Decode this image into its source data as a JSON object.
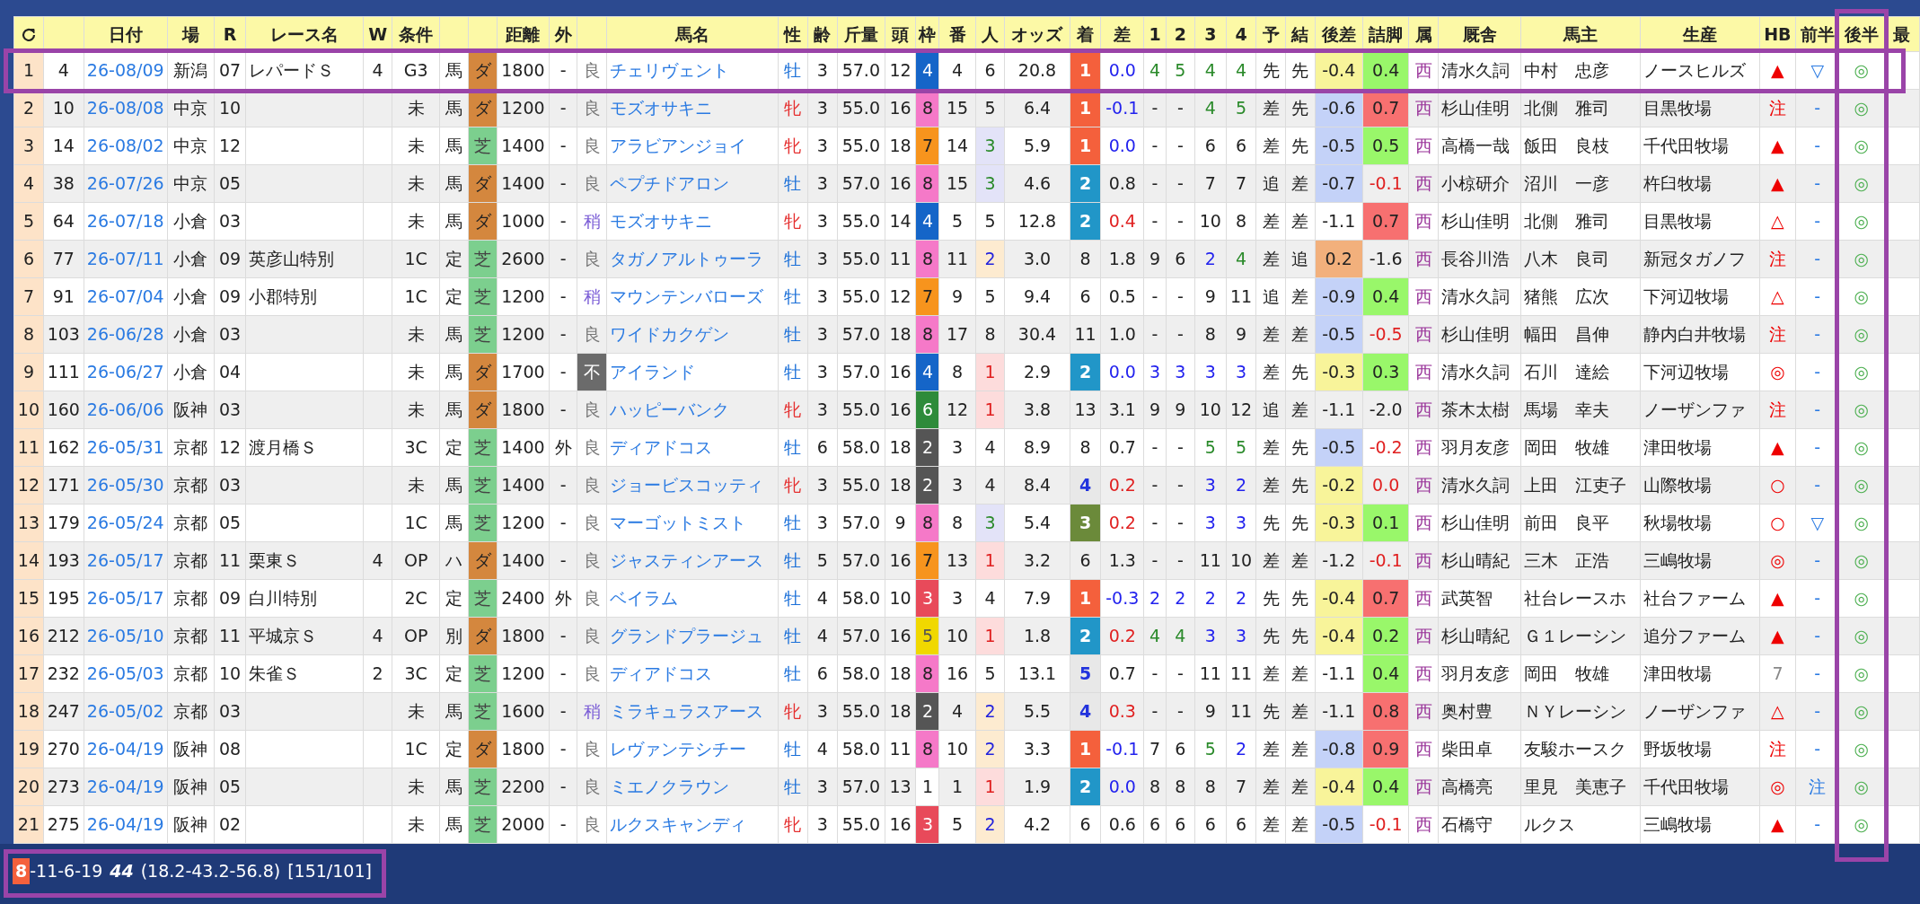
{
  "columns": [
    {
      "kind": "index"
    },
    {
      "kind": "plain"
    },
    {
      "kind": "link",
      "label": "日付"
    },
    {
      "kind": "plain",
      "label": "場"
    },
    {
      "kind": "plain",
      "label": "R"
    },
    {
      "kind": "plain",
      "label": "レース名"
    },
    {
      "kind": "plain",
      "label": "W"
    },
    {
      "kind": "plain",
      "label": "条件"
    },
    {
      "kind": "plain"
    },
    {
      "kind": "plain"
    },
    {
      "kind": "plain",
      "label": "距離"
    },
    {
      "kind": "plain",
      "label": "外"
    },
    {
      "kind": "plain"
    },
    {
      "kind": "link",
      "label": "馬名"
    },
    {
      "kind": "plain",
      "label": "性"
    },
    {
      "kind": "plain",
      "label": "齢"
    },
    {
      "kind": "plain",
      "label": "斤量"
    },
    {
      "kind": "plain",
      "label": "頭"
    },
    {
      "kind": "plain",
      "label": "枠"
    },
    {
      "kind": "plain",
      "label": "番"
    },
    {
      "kind": "plain",
      "label": "人"
    },
    {
      "kind": "plain",
      "label": "オッズ"
    },
    {
      "kind": "rank",
      "label": "着"
    },
    {
      "kind": "plain",
      "label": "差"
    },
    {
      "kind": "plain",
      "label": "1"
    },
    {
      "kind": "plain",
      "label": "2"
    },
    {
      "kind": "plain",
      "label": "3"
    },
    {
      "kind": "plain",
      "label": "4"
    },
    {
      "kind": "plain",
      "label": "予"
    },
    {
      "kind": "plain",
      "label": "結"
    },
    {
      "kind": "plain",
      "label": "後差"
    },
    {
      "kind": "plain",
      "label": "詰脚"
    },
    {
      "kind": "plain",
      "label": "属"
    },
    {
      "kind": "plain",
      "label": "厩舎"
    },
    {
      "kind": "plain",
      "label": "馬主"
    },
    {
      "kind": "plain",
      "label": "生産"
    },
    {
      "kind": "plain",
      "label": "HB"
    },
    {
      "kind": "plain",
      "label": "前半"
    },
    {
      "kind": "plain",
      "label": "後半",
      "highlighted": true
    },
    {
      "kind": "plain",
      "label": "最"
    }
  ],
  "rows": [
    {
      "highlighted": true,
      "cells": [
        "1",
        "4",
        "26-08/09",
        "新潟",
        "07",
        "レパードＳ",
        "4",
        "G3",
        "馬",
        {
          "kind": "fill",
          "text": "ダ",
          "color": "#d4873e"
        },
        "1800",
        "-",
        {
          "text": "良",
          "color": "#777777"
        },
        "チェリヴェント",
        {
          "text": "牡",
          "color": "#1a6fd8"
        },
        "3",
        "57.0",
        "12",
        {
          "kind": "fill",
          "color": "#1565c8",
          "label": {
            "text": "4",
            "color": "#ffffff"
          }
        },
        "4",
        "6",
        "20.8",
        {
          "kind": "fill",
          "color": "#f4603c",
          "label": {
            "text": "1",
            "color": "#ffffff"
          }
        },
        {
          "text": "0.0",
          "color": "#2222ee"
        },
        {
          "text": "4",
          "color": "#2a8a2a"
        },
        {
          "text": "5",
          "color": "#2a8a2a"
        },
        {
          "text": "4",
          "color": "#2a8a2a"
        },
        {
          "text": "4",
          "color": "#2a8a2a"
        },
        "先",
        "先",
        {
          "kind": "fill",
          "text": "-0.4",
          "color": "#f8f49a"
        },
        {
          "kind": "fill",
          "text": "0.4",
          "color": "#99f76a"
        },
        {
          "text": "西",
          "color": "#993399"
        },
        "清水久詞",
        "中村　忠彦",
        "ノースヒルズ",
        {
          "text": "▲",
          "color": "#ee0000"
        },
        {
          "text": "▽",
          "color": "#2a7ae2"
        },
        {
          "text": "◎",
          "color": "#4caf50"
        }
      ]
    },
    {
      "highlighted": false,
      "cells": [
        "2",
        "10",
        "26-08/08",
        "中京",
        "10",
        null,
        null,
        "未",
        "馬",
        {
          "kind": "fill",
          "text": "ダ",
          "color": "#d4873e"
        },
        "1200",
        "-",
        {
          "text": "良",
          "color": "#777777"
        },
        "モズオサキニ",
        {
          "text": "牝",
          "color": "#e53030"
        },
        "3",
        "55.0",
        "16",
        {
          "kind": "fill",
          "text": "8",
          "color": "#f579c8"
        },
        "15",
        "5",
        "6.4",
        {
          "kind": "fill",
          "color": "#f4603c",
          "label": {
            "text": "1",
            "color": "#ffffff"
          }
        },
        {
          "text": "-0.1",
          "color": "#2222ee"
        },
        "-",
        "-",
        {
          "text": "4",
          "color": "#2a8a2a"
        },
        {
          "text": "5",
          "color": "#2a8a2a"
        },
        "差",
        "先",
        {
          "kind": "fill",
          "text": "-0.6",
          "color": "#c4d2f8"
        },
        {
          "kind": "fill",
          "text": "0.7",
          "color": "#f77070"
        },
        {
          "text": "西",
          "color": "#993399"
        },
        "杉山佳明",
        "北側　雅司",
        "目黒牧場",
        {
          "text": "注",
          "color": "#ee0000"
        },
        {
          "text": "-",
          "color": "#2a7ae2"
        },
        {
          "text": "◎",
          "color": "#4caf50"
        }
      ]
    },
    {
      "highlighted": false,
      "cells": [
        "3",
        "14",
        "26-08/02",
        "中京",
        "12",
        null,
        null,
        "未",
        "馬",
        {
          "kind": "fill",
          "color": "#7ccf8e",
          "label": {
            "text": "芝",
            "color": "#444444"
          }
        },
        "1400",
        "-",
        {
          "text": "良",
          "color": "#777777"
        },
        "アラビアンジョイ",
        {
          "text": "牝",
          "color": "#e53030"
        },
        "3",
        "55.0",
        "18",
        {
          "kind": "fill",
          "text": "7",
          "color": "#f7941d"
        },
        "14",
        {
          "kind": "fill",
          "color": "#e3e3f8",
          "label": {
            "text": "3",
            "color": "#2a8a2a"
          }
        },
        "5.9",
        {
          "kind": "fill",
          "color": "#f4603c",
          "label": {
            "text": "1",
            "color": "#ffffff"
          }
        },
        {
          "text": "0.0",
          "color": "#2222ee"
        },
        "-",
        "-",
        "6",
        "6",
        "差",
        "先",
        {
          "kind": "fill",
          "text": "-0.5",
          "color": "#c4d2f8"
        },
        {
          "kind": "fill",
          "text": "0.5",
          "color": "#99f76a"
        },
        {
          "text": "西",
          "color": "#993399"
        },
        "高橋一哉",
        "飯田　良枝",
        "千代田牧場",
        {
          "text": "▲",
          "color": "#ee0000"
        },
        {
          "text": "-",
          "color": "#2a7ae2"
        },
        {
          "text": "◎",
          "color": "#4caf50"
        }
      ]
    },
    {
      "highlighted": false,
      "cells": [
        "4",
        "38",
        "26-07/26",
        "中京",
        "05",
        null,
        null,
        "未",
        "馬",
        {
          "kind": "fill",
          "text": "ダ",
          "color": "#d4873e"
        },
        "1400",
        "-",
        {
          "text": "良",
          "color": "#777777"
        },
        "ペプチドアロン",
        {
          "text": "牡",
          "color": "#1a6fd8"
        },
        "3",
        "57.0",
        "16",
        {
          "kind": "fill",
          "text": "8",
          "color": "#f579c8"
        },
        "15",
        {
          "kind": "fill",
          "color": "#e3e3f8",
          "label": {
            "text": "3",
            "color": "#2a8a2a"
          }
        },
        "4.6",
        {
          "kind": "fill",
          "color": "#2196c8",
          "label": {
            "text": "2",
            "color": "#ffffff"
          }
        },
        "0.8",
        "-",
        "-",
        "7",
        "7",
        "追",
        "差",
        {
          "kind": "fill",
          "text": "-0.7",
          "color": "#c4d2f8"
        },
        {
          "text": "-0.1",
          "color": "#e02020"
        },
        {
          "text": "西",
          "color": "#993399"
        },
        "小椋研介",
        "沼川　一彦",
        "杵臼牧場",
        {
          "text": "▲",
          "color": "#ee0000"
        },
        {
          "text": "-",
          "color": "#2a7ae2"
        },
        {
          "text": "◎",
          "color": "#4caf50"
        }
      ]
    },
    {
      "highlighted": false,
      "cells": [
        "5",
        "64",
        "26-07/18",
        "小倉",
        "03",
        null,
        null,
        "未",
        "馬",
        {
          "kind": "fill",
          "text": "ダ",
          "color": "#d4873e"
        },
        "1000",
        "-",
        {
          "text": "稍",
          "color": "#7a5cd6"
        },
        "モズオサキニ",
        {
          "text": "牝",
          "color": "#e53030"
        },
        "3",
        "55.0",
        "14",
        {
          "kind": "fill",
          "color": "#1565c8",
          "label": {
            "text": "4",
            "color": "#ffffff"
          }
        },
        "5",
        "5",
        "12.8",
        {
          "kind": "fill",
          "color": "#2196c8",
          "label": {
            "text": "2",
            "color": "#ffffff"
          }
        },
        {
          "text": "0.4",
          "color": "#e02020"
        },
        "-",
        "-",
        "10",
        "8",
        "差",
        "差",
        "-1.1",
        {
          "kind": "fill",
          "text": "0.7",
          "color": "#f77070"
        },
        {
          "text": "西",
          "color": "#993399"
        },
        "杉山佳明",
        "北側　雅司",
        "目黒牧場",
        {
          "text": "△",
          "color": "#ee0000"
        },
        {
          "text": "-",
          "color": "#2a7ae2"
        },
        {
          "text": "◎",
          "color": "#4caf50"
        }
      ]
    },
    {
      "highlighted": false,
      "cells": [
        "6",
        "77",
        "26-07/11",
        "小倉",
        "09",
        "英彦山特別",
        null,
        "1C",
        "定",
        {
          "kind": "fill",
          "color": "#7ccf8e",
          "label": {
            "text": "芝",
            "color": "#444444"
          }
        },
        "2600",
        "-",
        {
          "text": "良",
          "color": "#777777"
        },
        "タガノアルトゥーラ",
        {
          "text": "牡",
          "color": "#1a6fd8"
        },
        "3",
        "55.0",
        "11",
        {
          "kind": "fill",
          "text": "8",
          "color": "#f579c8"
        },
        "11",
        {
          "kind": "fill",
          "color": "#fdebd0",
          "label": {
            "text": "2",
            "color": "#2222dd"
          }
        },
        "3.0",
        "8",
        "1.8",
        "9",
        "6",
        {
          "text": "2",
          "color": "#2222ee"
        },
        {
          "text": "4",
          "color": "#2a8a2a"
        },
        "差",
        "追",
        {
          "kind": "fill",
          "text": "0.2",
          "color": "#f2b07c"
        },
        "-1.6",
        {
          "text": "西",
          "color": "#993399"
        },
        "長谷川浩",
        "八木　良司",
        "新冠タガノフ",
        {
          "text": "注",
          "color": "#ee0000"
        },
        {
          "text": "-",
          "color": "#2a7ae2"
        },
        {
          "text": "◎",
          "color": "#4caf50"
        }
      ]
    },
    {
      "highlighted": false,
      "cells": [
        "7",
        "91",
        "26-07/04",
        "小倉",
        "09",
        "小郡特別",
        null,
        "1C",
        "定",
        {
          "kind": "fill",
          "color": "#7ccf8e",
          "label": {
            "text": "芝",
            "color": "#444444"
          }
        },
        "1200",
        "-",
        {
          "text": "稍",
          "color": "#7a5cd6"
        },
        "マウンテンバローズ",
        {
          "text": "牡",
          "color": "#1a6fd8"
        },
        "3",
        "55.0",
        "12",
        {
          "kind": "fill",
          "text": "7",
          "color": "#f7941d"
        },
        "9",
        "5",
        "9.4",
        "6",
        "0.5",
        "-",
        "-",
        "9",
        "11",
        "追",
        "差",
        {
          "kind": "fill",
          "text": "-0.9",
          "color": "#c4d2f8"
        },
        {
          "kind": "fill",
          "text": "0.4",
          "color": "#99f76a"
        },
        {
          "text": "西",
          "color": "#993399"
        },
        "清水久詞",
        "猪熊　広次",
        "下河辺牧場",
        {
          "text": "△",
          "color": "#ee0000"
        },
        {
          "text": "-",
          "color": "#2a7ae2"
        },
        {
          "text": "◎",
          "color": "#4caf50"
        }
      ]
    },
    {
      "highlighted": false,
      "cells": [
        "8",
        "103",
        "26-06/28",
        "小倉",
        "03",
        null,
        null,
        "未",
        "馬",
        {
          "kind": "fill",
          "color": "#7ccf8e",
          "label": {
            "text": "芝",
            "color": "#444444"
          }
        },
        "1200",
        "-",
        {
          "text": "良",
          "color": "#777777"
        },
        "ワイドカクゲン",
        {
          "text": "牡",
          "color": "#1a6fd8"
        },
        "3",
        "57.0",
        "18",
        {
          "kind": "fill",
          "text": "8",
          "color": "#f579c8"
        },
        "17",
        "8",
        "30.4",
        "11",
        "1.0",
        "-",
        "-",
        "8",
        "9",
        "差",
        "差",
        {
          "kind": "fill",
          "text": "-0.5",
          "color": "#c4d2f8"
        },
        {
          "text": "-0.5",
          "color": "#e02020"
        },
        {
          "text": "西",
          "color": "#993399"
        },
        "杉山佳明",
        "幅田　昌伸",
        "静内白井牧場",
        {
          "text": "注",
          "color": "#ee0000"
        },
        {
          "text": "-",
          "color": "#2a7ae2"
        },
        {
          "text": "◎",
          "color": "#4caf50"
        }
      ]
    },
    {
      "highlighted": false,
      "cells": [
        "9",
        "111",
        "26-06/27",
        "小倉",
        "04",
        null,
        null,
        "未",
        "馬",
        {
          "kind": "fill",
          "text": "ダ",
          "color": "#d4873e"
        },
        "1700",
        "-",
        {
          "kind": "fill",
          "color": "#6b6b6b",
          "label": {
            "text": "不",
            "color": "#ffffff"
          }
        },
        "アイランド",
        {
          "text": "牡",
          "color": "#1a6fd8"
        },
        "3",
        "57.0",
        "16",
        {
          "kind": "fill",
          "color": "#1565c8",
          "label": {
            "text": "4",
            "color": "#ffffff"
          }
        },
        "8",
        {
          "kind": "fill",
          "color": "#fddcdc",
          "label": {
            "text": "1",
            "color": "#e02020"
          }
        },
        "2.9",
        {
          "kind": "fill",
          "color": "#2196c8",
          "label": {
            "text": "2",
            "color": "#ffffff"
          }
        },
        {
          "text": "0.0",
          "color": "#2222ee"
        },
        {
          "text": "3",
          "color": "#2222ee"
        },
        {
          "text": "3",
          "color": "#2222ee"
        },
        {
          "text": "3",
          "color": "#2222ee"
        },
        {
          "text": "3",
          "color": "#2222ee"
        },
        "差",
        "先",
        {
          "kind": "fill",
          "text": "-0.3",
          "color": "#f8f49a"
        },
        {
          "kind": "fill",
          "text": "0.3",
          "color": "#99f76a"
        },
        {
          "text": "西",
          "color": "#993399"
        },
        "清水久詞",
        "石川　達絵",
        "下河辺牧場",
        {
          "text": "◎",
          "color": "#ee0000"
        },
        {
          "text": "-",
          "color": "#2a7ae2"
        },
        {
          "text": "◎",
          "color": "#4caf50"
        }
      ]
    },
    {
      "highlighted": false,
      "cells": [
        "10",
        "160",
        "26-06/06",
        "阪神",
        "03",
        null,
        null,
        "未",
        "馬",
        {
          "kind": "fill",
          "text": "ダ",
          "color": "#d4873e"
        },
        "1800",
        "-",
        {
          "text": "良",
          "color": "#777777"
        },
        "ハッピーバンク",
        {
          "text": "牝",
          "color": "#e53030"
        },
        "3",
        "55.0",
        "16",
        {
          "kind": "fill",
          "color": "#2e8b3a",
          "label": {
            "text": "6",
            "color": "#ffffff"
          }
        },
        "12",
        {
          "kind": "fill",
          "color": "#fddcdc",
          "label": {
            "text": "1",
            "color": "#e02020"
          }
        },
        "3.8",
        "13",
        "3.1",
        "9",
        "9",
        "10",
        "12",
        "追",
        "差",
        "-1.1",
        "-2.0",
        {
          "text": "西",
          "color": "#993399"
        },
        "茶木太樹",
        "馬場　幸夫",
        "ノーザンファ",
        {
          "text": "注",
          "color": "#ee0000"
        },
        {
          "text": "-",
          "color": "#2a7ae2"
        },
        {
          "text": "◎",
          "color": "#4caf50"
        }
      ]
    },
    {
      "highlighted": false,
      "cells": [
        "11",
        "162",
        "26-05/31",
        "京都",
        "12",
        "渡月橋Ｓ",
        null,
        "3C",
        "定",
        {
          "kind": "fill",
          "color": "#7ccf8e",
          "label": {
            "text": "芝",
            "color": "#444444"
          }
        },
        "1400",
        "外",
        {
          "text": "良",
          "color": "#777777"
        },
        "ディアドコス",
        {
          "text": "牡",
          "color": "#1a6fd8"
        },
        "6",
        "58.0",
        "18",
        {
          "kind": "fill",
          "color": "#555555",
          "label": {
            "text": "2",
            "color": "#ffffff"
          }
        },
        "3",
        "4",
        "8.9",
        "8",
        "0.7",
        "-",
        "-",
        {
          "text": "5",
          "color": "#2a8a2a"
        },
        {
          "text": "5",
          "color": "#2a8a2a"
        },
        "差",
        "先",
        {
          "kind": "fill",
          "text": "-0.5",
          "color": "#c4d2f8"
        },
        {
          "text": "-0.2",
          "color": "#e02020"
        },
        {
          "text": "西",
          "color": "#993399"
        },
        "羽月友彦",
        "岡田　牧雄",
        "津田牧場",
        {
          "text": "▲",
          "color": "#ee0000"
        },
        {
          "text": "-",
          "color": "#2a7ae2"
        },
        {
          "text": "◎",
          "color": "#4caf50"
        }
      ]
    },
    {
      "highlighted": false,
      "cells": [
        "12",
        "171",
        "26-05/30",
        "京都",
        "03",
        null,
        null,
        "未",
        "馬",
        {
          "kind": "fill",
          "color": "#7ccf8e",
          "label": {
            "text": "芝",
            "color": "#444444"
          }
        },
        "1400",
        "-",
        {
          "text": "良",
          "color": "#777777"
        },
        "ジョービスコッティ",
        {
          "text": "牝",
          "color": "#e53030"
        },
        "3",
        "55.0",
        "18",
        {
          "kind": "fill",
          "color": "#555555",
          "label": {
            "text": "2",
            "color": "#ffffff"
          }
        },
        "3",
        "4",
        "8.4",
        {
          "kind": "fill",
          "color": "#e8e8e8",
          "label": {
            "text": "4",
            "color": "#2233dd"
          }
        },
        {
          "text": "0.2",
          "color": "#e02020"
        },
        "-",
        "-",
        {
          "text": "3",
          "color": "#2222ee"
        },
        {
          "text": "2",
          "color": "#2222ee"
        },
        "差",
        "先",
        {
          "kind": "fill",
          "text": "-0.2",
          "color": "#f8f49a"
        },
        {
          "text": "0.0",
          "color": "#e02020"
        },
        {
          "text": "西",
          "color": "#993399"
        },
        "清水久詞",
        "上田　江吏子",
        "山際牧場",
        {
          "text": "○",
          "color": "#ee0000"
        },
        {
          "text": "-",
          "color": "#2a7ae2"
        },
        {
          "text": "◎",
          "color": "#4caf50"
        }
      ]
    },
    {
      "highlighted": false,
      "cells": [
        "13",
        "179",
        "26-05/24",
        "京都",
        "05",
        null,
        null,
        "1C",
        "馬",
        {
          "kind": "fill",
          "color": "#7ccf8e",
          "label": {
            "text": "芝",
            "color": "#444444"
          }
        },
        "1200",
        "-",
        {
          "text": "良",
          "color": "#777777"
        },
        "マーゴットミスト",
        {
          "text": "牡",
          "color": "#1a6fd8"
        },
        "3",
        "57.0",
        "9",
        {
          "kind": "fill",
          "text": "8",
          "color": "#f579c8"
        },
        "8",
        {
          "kind": "fill",
          "color": "#e3e3f8",
          "label": {
            "text": "3",
            "color": "#2a8a2a"
          }
        },
        "5.4",
        {
          "kind": "fill",
          "color": "#6b8a3a",
          "label": {
            "text": "3",
            "color": "#ffffff"
          }
        },
        {
          "text": "0.2",
          "color": "#e02020"
        },
        "-",
        "-",
        {
          "text": "3",
          "color": "#2222ee"
        },
        {
          "text": "3",
          "color": "#2222ee"
        },
        "先",
        "先",
        {
          "kind": "fill",
          "text": "-0.3",
          "color": "#f8f49a"
        },
        {
          "kind": "fill",
          "text": "0.1",
          "color": "#99f76a"
        },
        {
          "text": "西",
          "color": "#993399"
        },
        "杉山佳明",
        "前田　良平",
        "秋場牧場",
        {
          "text": "○",
          "color": "#ee0000"
        },
        {
          "text": "▽",
          "color": "#2a7ae2"
        },
        {
          "text": "◎",
          "color": "#4caf50"
        }
      ]
    },
    {
      "highlighted": false,
      "cells": [
        "14",
        "193",
        "26-05/17",
        "京都",
        "11",
        "栗東Ｓ",
        "4",
        "OP",
        "ハ",
        {
          "kind": "fill",
          "text": "ダ",
          "color": "#d4873e"
        },
        "1400",
        "-",
        {
          "text": "良",
          "color": "#777777"
        },
        "ジャスティンアース",
        {
          "text": "牡",
          "color": "#1a6fd8"
        },
        "5",
        "57.0",
        "16",
        {
          "kind": "fill",
          "text": "7",
          "color": "#f7941d"
        },
        "13",
        {
          "kind": "fill",
          "color": "#fddcdc",
          "label": {
            "text": "1",
            "color": "#e02020"
          }
        },
        "3.2",
        "6",
        "1.3",
        "-",
        "-",
        "11",
        "10",
        "差",
        "差",
        "-1.2",
        {
          "text": "-0.1",
          "color": "#e02020"
        },
        {
          "text": "西",
          "color": "#993399"
        },
        "杉山晴紀",
        "三木　正浩",
        "三嶋牧場",
        {
          "text": "◎",
          "color": "#ee0000"
        },
        {
          "text": "-",
          "color": "#2a7ae2"
        },
        {
          "text": "◎",
          "color": "#4caf50"
        }
      ]
    },
    {
      "highlighted": false,
      "cells": [
        "15",
        "195",
        "26-05/17",
        "京都",
        "09",
        "白川特別",
        null,
        "2C",
        "定",
        {
          "kind": "fill",
          "color": "#7ccf8e",
          "label": {
            "text": "芝",
            "color": "#444444"
          }
        },
        "2400",
        "外",
        {
          "text": "良",
          "color": "#777777"
        },
        "ベイラム",
        {
          "text": "牡",
          "color": "#1a6fd8"
        },
        "4",
        "58.0",
        "10",
        {
          "kind": "fill",
          "color": "#e84a5a",
          "label": {
            "text": "3",
            "color": "#ffffff"
          }
        },
        "3",
        "4",
        "7.9",
        {
          "kind": "fill",
          "color": "#f4603c",
          "label": {
            "text": "1",
            "color": "#ffffff"
          }
        },
        {
          "text": "-0.3",
          "color": "#2222ee"
        },
        {
          "text": "2",
          "color": "#2222ee"
        },
        {
          "text": "2",
          "color": "#2222ee"
        },
        {
          "text": "2",
          "color": "#2222ee"
        },
        {
          "text": "2",
          "color": "#2222ee"
        },
        "先",
        "先",
        {
          "kind": "fill",
          "text": "-0.4",
          "color": "#f8f49a"
        },
        {
          "kind": "fill",
          "text": "0.7",
          "color": "#f77070"
        },
        {
          "text": "西",
          "color": "#993399"
        },
        "武英智",
        "社台レースホ",
        "社台ファーム",
        {
          "text": "▲",
          "color": "#ee0000"
        },
        {
          "text": "-",
          "color": "#2a7ae2"
        },
        {
          "text": "◎",
          "color": "#4caf50"
        }
      ]
    },
    {
      "highlighted": false,
      "cells": [
        "16",
        "212",
        "26-05/10",
        "京都",
        "11",
        "平城京Ｓ",
        "4",
        "OP",
        "別",
        {
          "kind": "fill",
          "text": "ダ",
          "color": "#d4873e"
        },
        "1800",
        "-",
        {
          "text": "良",
          "color": "#777777"
        },
        "グランドプラージュ",
        {
          "text": "牡",
          "color": "#1a6fd8"
        },
        "4",
        "57.0",
        "16",
        {
          "kind": "fill",
          "color": "#f0d800",
          "label": {
            "text": "5",
            "color": "#555555"
          }
        },
        "10",
        {
          "kind": "fill",
          "color": "#fddcdc",
          "label": {
            "text": "1",
            "color": "#e02020"
          }
        },
        "1.8",
        {
          "kind": "fill",
          "color": "#2196c8",
          "label": {
            "text": "2",
            "color": "#ffffff"
          }
        },
        {
          "text": "0.2",
          "color": "#e02020"
        },
        {
          "text": "4",
          "color": "#2a8a2a"
        },
        {
          "text": "4",
          "color": "#2a8a2a"
        },
        {
          "text": "3",
          "color": "#2222ee"
        },
        {
          "text": "3",
          "color": "#2222ee"
        },
        "先",
        "先",
        {
          "kind": "fill",
          "text": "-0.4",
          "color": "#f8f49a"
        },
        {
          "kind": "fill",
          "text": "0.2",
          "color": "#99f76a"
        },
        {
          "text": "西",
          "color": "#993399"
        },
        "杉山晴紀",
        "Ｇ１レーシン",
        "追分ファーム",
        {
          "text": "▲",
          "color": "#ee0000"
        },
        {
          "text": "-",
          "color": "#2a7ae2"
        },
        {
          "text": "◎",
          "color": "#4caf50"
        }
      ]
    },
    {
      "highlighted": false,
      "cells": [
        "17",
        "232",
        "26-05/03",
        "京都",
        "10",
        "朱雀Ｓ",
        "2",
        "3C",
        "定",
        {
          "kind": "fill",
          "color": "#7ccf8e",
          "label": {
            "text": "芝",
            "color": "#444444"
          }
        },
        "1200",
        "-",
        {
          "text": "良",
          "color": "#777777"
        },
        "ディアドコス",
        {
          "text": "牡",
          "color": "#1a6fd8"
        },
        "6",
        "58.0",
        "18",
        {
          "kind": "fill",
          "text": "8",
          "color": "#f579c8"
        },
        "16",
        "5",
        "13.1",
        {
          "kind": "fill",
          "color": "#e8e8e8",
          "label": {
            "text": "5",
            "color": "#2233dd"
          }
        },
        "0.7",
        "-",
        "-",
        "11",
        "11",
        "差",
        "差",
        "-1.1",
        {
          "kind": "fill",
          "text": "0.4",
          "color": "#99f76a"
        },
        {
          "text": "西",
          "color": "#993399"
        },
        "羽月友彦",
        "岡田　牧雄",
        "津田牧場",
        {
          "text": "7",
          "color": "#888888"
        },
        {
          "text": "-",
          "color": "#2a7ae2"
        },
        {
          "text": "◎",
          "color": "#4caf50"
        }
      ]
    },
    {
      "highlighted": false,
      "cells": [
        "18",
        "247",
        "26-05/02",
        "京都",
        "03",
        null,
        null,
        "未",
        "馬",
        {
          "kind": "fill",
          "color": "#7ccf8e",
          "label": {
            "text": "芝",
            "color": "#444444"
          }
        },
        "1600",
        "-",
        {
          "text": "稍",
          "color": "#7a5cd6"
        },
        "ミラキュラスアース",
        {
          "text": "牝",
          "color": "#e53030"
        },
        "3",
        "55.0",
        "18",
        {
          "kind": "fill",
          "color": "#555555",
          "label": {
            "text": "2",
            "color": "#ffffff"
          }
        },
        "4",
        {
          "kind": "fill",
          "color": "#fdebd0",
          "label": {
            "text": "2",
            "color": "#2222dd"
          }
        },
        "5.5",
        {
          "kind": "fill",
          "color": "#e8e8e8",
          "label": {
            "text": "4",
            "color": "#2233dd"
          }
        },
        {
          "text": "0.3",
          "color": "#e02020"
        },
        "-",
        "-",
        "9",
        "11",
        "先",
        "差",
        "-1.1",
        {
          "kind": "fill",
          "text": "0.8",
          "color": "#f77070"
        },
        {
          "text": "西",
          "color": "#993399"
        },
        "奥村豊",
        "ＮＹレーシン",
        "ノーザンファ",
        {
          "text": "△",
          "color": "#ee0000"
        },
        {
          "text": "-",
          "color": "#2a7ae2"
        },
        {
          "text": "◎",
          "color": "#4caf50"
        }
      ]
    },
    {
      "highlighted": false,
      "cells": [
        "19",
        "270",
        "26-04/19",
        "阪神",
        "08",
        null,
        null,
        "1C",
        "定",
        {
          "kind": "fill",
          "text": "ダ",
          "color": "#d4873e"
        },
        "1800",
        "-",
        {
          "text": "良",
          "color": "#777777"
        },
        "レヴァンテシチー",
        {
          "text": "牡",
          "color": "#1a6fd8"
        },
        "4",
        "58.0",
        "11",
        {
          "kind": "fill",
          "text": "8",
          "color": "#f579c8"
        },
        "10",
        {
          "kind": "fill",
          "color": "#fdebd0",
          "label": {
            "text": "2",
            "color": "#2222dd"
          }
        },
        "3.3",
        {
          "kind": "fill",
          "color": "#f4603c",
          "label": {
            "text": "1",
            "color": "#ffffff"
          }
        },
        {
          "text": "-0.1",
          "color": "#2222ee"
        },
        "7",
        "6",
        {
          "text": "5",
          "color": "#2a8a2a"
        },
        {
          "text": "2",
          "color": "#2222ee"
        },
        "差",
        "差",
        {
          "kind": "fill",
          "text": "-0.8",
          "color": "#c4d2f8"
        },
        {
          "kind": "fill",
          "text": "0.9",
          "color": "#f77070"
        },
        {
          "text": "西",
          "color": "#993399"
        },
        "柴田卓",
        "友駿ホースク",
        "野坂牧場",
        {
          "text": "注",
          "color": "#ee0000"
        },
        {
          "text": "-",
          "color": "#2a7ae2"
        },
        {
          "text": "◎",
          "color": "#4caf50"
        }
      ]
    },
    {
      "highlighted": false,
      "cells": [
        "20",
        "273",
        "26-04/19",
        "阪神",
        "05",
        null,
        null,
        "未",
        "馬",
        {
          "kind": "fill",
          "color": "#7ccf8e",
          "label": {
            "text": "芝",
            "color": "#444444"
          }
        },
        "2200",
        "-",
        {
          "text": "良",
          "color": "#777777"
        },
        "ミエノクラウン",
        {
          "text": "牡",
          "color": "#1a6fd8"
        },
        "3",
        "57.0",
        "13",
        {
          "kind": "fill",
          "text": "1",
          "color": "#ffffff"
        },
        "1",
        {
          "kind": "fill",
          "color": "#fddcdc",
          "label": {
            "text": "1",
            "color": "#e02020"
          }
        },
        "1.9",
        {
          "kind": "fill",
          "color": "#2196c8",
          "label": {
            "text": "2",
            "color": "#ffffff"
          }
        },
        {
          "text": "0.0",
          "color": "#2222ee"
        },
        "8",
        "8",
        "8",
        "7",
        "差",
        "差",
        {
          "kind": "fill",
          "text": "-0.4",
          "color": "#f8f49a"
        },
        {
          "kind": "fill",
          "text": "0.4",
          "color": "#99f76a"
        },
        {
          "text": "西",
          "color": "#993399"
        },
        "高橋亮",
        "里見　美恵子",
        "千代田牧場",
        {
          "text": "◎",
          "color": "#ee0000"
        },
        {
          "text": "注",
          "color": "#2a7ae2"
        },
        {
          "text": "◎",
          "color": "#4caf50"
        }
      ]
    },
    {
      "highlighted": false,
      "cells": [
        "21",
        "275",
        "26-04/19",
        "阪神",
        "02",
        null,
        null,
        "未",
        "馬",
        {
          "kind": "fill",
          "color": "#7ccf8e",
          "label": {
            "text": "芝",
            "color": "#444444"
          }
        },
        "2000",
        "-",
        {
          "text": "良",
          "color": "#777777"
        },
        "ルクスキャンディ",
        {
          "text": "牝",
          "color": "#e53030"
        },
        "3",
        "55.0",
        "16",
        {
          "kind": "fill",
          "color": "#e84a5a",
          "label": {
            "text": "3",
            "color": "#ffffff"
          }
        },
        "5",
        {
          "kind": "fill",
          "color": "#fdebd0",
          "label": {
            "text": "2",
            "color": "#2222dd"
          }
        },
        "4.2",
        "6",
        "0.6",
        "6",
        "6",
        "6",
        "6",
        "差",
        "差",
        {
          "kind": "fill",
          "text": "-0.5",
          "color": "#c4d2f8"
        },
        {
          "text": "-0.1",
          "color": "#e02020"
        },
        {
          "text": "西",
          "color": "#993399"
        },
        "石橋守",
        "ルクス",
        "三嶋牧場",
        {
          "text": "▲",
          "color": "#ee0000"
        },
        {
          "text": "-",
          "color": "#2a7ae2"
        },
        {
          "text": "◎",
          "color": "#4caf50"
        }
      ]
    }
  ],
  "footer": {
    "highlighted": true,
    "lead": {
      "text": "8",
      "color": "#f4603c"
    },
    "record": "-11-6-19",
    "score": "44",
    "times": "(18.2-43.2-56.8)",
    "counts": "[151/101]"
  }
}
